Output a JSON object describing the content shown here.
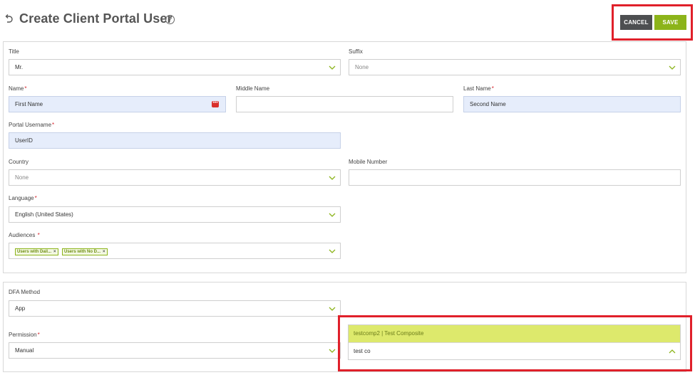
{
  "header": {
    "title": "Create Client Portal User",
    "help_glyph": "?",
    "cancel_label": "CANCEL",
    "save_label": "SAVE"
  },
  "form": {
    "title": {
      "label": "Title",
      "value": "Mr."
    },
    "suffix": {
      "label": "Suffix",
      "value": "None"
    },
    "name": {
      "label": "Name",
      "required": "*",
      "value": "First Name"
    },
    "middle_name": {
      "label": "Middle Name",
      "value": ""
    },
    "last_name": {
      "label": "Last Name",
      "required": "*",
      "value": "Second Name"
    },
    "portal_username": {
      "label": "Portal Username",
      "required": "*",
      "value": "UserID"
    },
    "country": {
      "label": "Country",
      "value": "None"
    },
    "mobile_number": {
      "label": "Mobile Number",
      "value": ""
    },
    "language": {
      "label": "Language",
      "required": "*",
      "value": "English (United States)"
    },
    "audiences": {
      "label": "Audiences",
      "required": "*",
      "tags": [
        "Users with Dail...",
        "Users with No D..."
      ],
      "remove_glyph": "×"
    }
  },
  "security": {
    "dfa_method": {
      "label": "DFA Method",
      "value": "App"
    },
    "permission": {
      "label": "Permission",
      "required": "*",
      "value": "Manual"
    },
    "lookup": {
      "option": "testcomp2 | Test Composite",
      "query": "test co"
    }
  },
  "colors": {
    "accent": "#8cb41a",
    "cancel": "#4d4f51",
    "required": "#d6262e",
    "highlight": "#e0202a",
    "dropdown_option": "#dde96c",
    "filled_field": "#e6edfb"
  },
  "icons": {
    "back": "back-arrow-icon",
    "help": "help-circle-icon",
    "chevron": "chevron-down-icon",
    "chevron_up": "chevron-up-icon",
    "password": "password-dots-icon"
  }
}
